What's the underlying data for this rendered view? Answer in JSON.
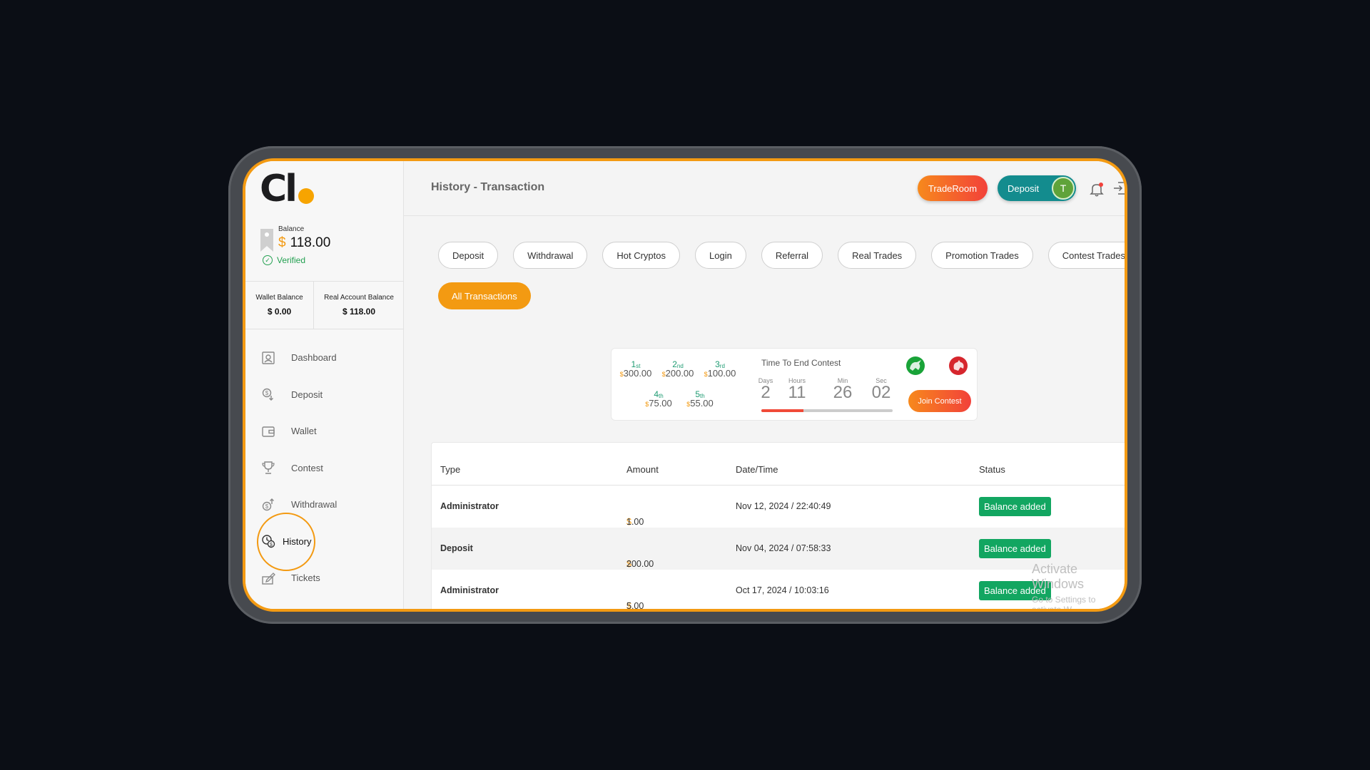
{
  "balance": {
    "label": "Balance",
    "currency": "$",
    "amount": "118.00",
    "verified": "Verified"
  },
  "accounts": {
    "wallet_label": "Wallet Balance",
    "wallet_value": "$ 0.00",
    "real_label": "Real Account Balance",
    "real_value": "$ 118.00"
  },
  "nav": {
    "dashboard": "Dashboard",
    "deposit": "Deposit",
    "wallet": "Wallet",
    "contest": "Contest",
    "withdrawal": "Withdrawal",
    "history": "History",
    "tickets": "Tickets"
  },
  "header": {
    "title": "History - Transaction",
    "traderoom": "TradeRoom",
    "deposit": "Deposit",
    "avatar_initial": "T"
  },
  "tabs": [
    "Deposit",
    "Withdrawal",
    "Hot Cryptos",
    "Login",
    "Referral",
    "Real Trades",
    "Promotion Trades",
    "Contest Trades"
  ],
  "active_tab": "All Transactions",
  "contest": {
    "prizes": [
      {
        "rank": "1",
        "suffix": "st",
        "amount": "300.00"
      },
      {
        "rank": "2",
        "suffix": "nd",
        "amount": "200.00"
      },
      {
        "rank": "3",
        "suffix": "rd",
        "amount": "100.00"
      },
      {
        "rank": "4",
        "suffix": "th",
        "amount": "75.00"
      },
      {
        "rank": "5",
        "suffix": "th",
        "amount": "55.00"
      }
    ],
    "currency": "$",
    "timer_title": "Time To End Contest",
    "days_label": "Days",
    "days": "2",
    "hours_label": "Hours",
    "hours": "11",
    "min_label": "Min",
    "min": "26",
    "sec_label": "Sec",
    "sec": "02",
    "progress_percent": 32,
    "join": "Join Contest"
  },
  "table": {
    "headers": {
      "type": "Type",
      "amount": "Amount",
      "datetime": "Date/Time",
      "status": "Status"
    },
    "currency": "$",
    "rows": [
      {
        "type": "Administrator",
        "amount": "1.00",
        "datetime": "Nov 12, 2024 / 22:40:49",
        "status": "Balance added"
      },
      {
        "type": "Deposit",
        "amount": "200.00",
        "datetime": "Nov 04, 2024 / 07:58:33",
        "status": "Balance added"
      },
      {
        "type": "Administrator",
        "amount": "5.00",
        "datetime": "Oct 17, 2024 / 10:03:16",
        "status": "Balance added"
      }
    ]
  },
  "watermark": {
    "title": "Activate Windows",
    "subtitle": "Go to Settings to activate W"
  },
  "colors": {
    "accent": "#f39a12",
    "teal": "#138c8e",
    "success": "#12a661",
    "danger": "#f2413a"
  }
}
